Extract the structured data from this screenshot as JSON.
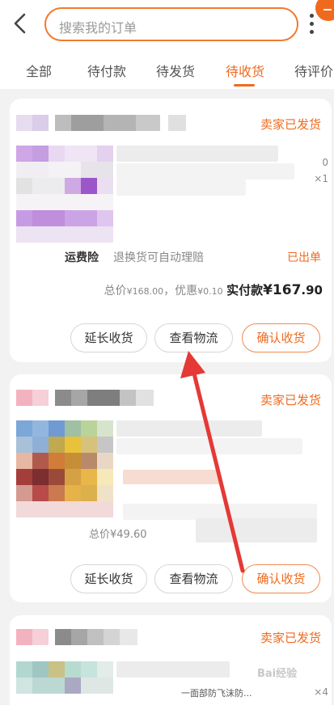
{
  "header": {
    "search_placeholder": "搜索我的订单"
  },
  "tabs": [
    {
      "label": "全部"
    },
    {
      "label": "待付款"
    },
    {
      "label": "待发货"
    },
    {
      "label": "待收货"
    },
    {
      "label": "待评价"
    }
  ],
  "active_tab": "待收货",
  "colors": {
    "accent": "#f06a1e",
    "annotation_arrow": "#e53935"
  },
  "orders": [
    {
      "status": "卖家已发货",
      "quantity": "×1",
      "price_fragment": "0",
      "shipping_insurance_label": "运费险",
      "shipping_insurance_desc": "退换货可自动理赔",
      "insurance_status": "已出单",
      "total_label": "总价",
      "total_amount_int": "¥168",
      "total_amount_dec": ".00",
      "discount_label": "，优惠",
      "discount_int": "¥0",
      "discount_dec": ".10",
      "pay_label": "实付款",
      "pay_int": "¥167",
      "pay_dec": ".90",
      "buttons": {
        "extend": "延长收货",
        "logistics": "查看物流",
        "confirm": "确认收货"
      }
    },
    {
      "status": "卖家已发货",
      "total_fragment": "总价¥49.60",
      "buttons": {
        "extend": "延长收货",
        "logistics": "查看物流",
        "confirm": "确认收货"
      }
    },
    {
      "status": "卖家已发货",
      "quantity": "×4",
      "title_fragment": "一面部防飞沫防..."
    }
  ],
  "watermark_text": "Bai经验"
}
